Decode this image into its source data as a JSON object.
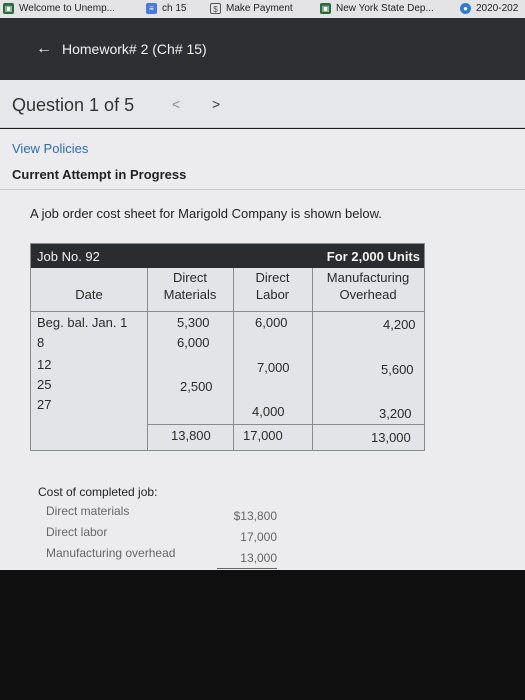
{
  "bookmarks": [
    {
      "label": "Welcome to Unemp...",
      "icon": "unemployment-icon"
    },
    {
      "label": "ch 15",
      "icon": "docs-icon"
    },
    {
      "label": "Make Payment",
      "icon": "payment-icon"
    },
    {
      "label": "New York State Dep...",
      "icon": "nys-icon"
    },
    {
      "label": "2020-202",
      "icon": "globe-icon"
    }
  ],
  "header": {
    "back_label": "Homework# 2 (Ch# 15)"
  },
  "question": {
    "title": "Question 1 of 5",
    "prev": "<",
    "next": ">"
  },
  "content": {
    "view_policies": "View Policies",
    "attempt": "Current Attempt in Progress",
    "intro": "A job order cost sheet for Marigold Company is shown below."
  },
  "sheet": {
    "job_no": "Job No. 92",
    "units": "For 2,000 Units",
    "headers": {
      "date": "Date",
      "dm": [
        "Direct",
        "Materials"
      ],
      "dl": [
        "Direct",
        "Labor"
      ],
      "moh": [
        "Manufacturing",
        "Overhead"
      ]
    },
    "rows": [
      {
        "date": "Beg. bal. Jan. 1",
        "dm": "5,300",
        "dl": "6,000",
        "moh": "4,200"
      },
      {
        "date": "8",
        "dm": "6,000",
        "dl": "",
        "moh": ""
      },
      {
        "date": "12",
        "dm": "",
        "dl": "7,000",
        "moh": "5,600"
      },
      {
        "date": "25",
        "dm": "2,500",
        "dl": "",
        "moh": ""
      },
      {
        "date": "27",
        "dm": "",
        "dl": "4,000",
        "moh": "3,200"
      }
    ],
    "totals": {
      "dm": "13,800",
      "dl": "17,000",
      "moh": "13,000"
    }
  },
  "completed": {
    "title": "Cost of completed job:",
    "items": [
      {
        "label": "Direct materials",
        "value": "$13,800"
      },
      {
        "label": "Direct labor",
        "value": "17,000"
      },
      {
        "label": "Manufacturing overhead",
        "value": "13,000"
      }
    ]
  }
}
